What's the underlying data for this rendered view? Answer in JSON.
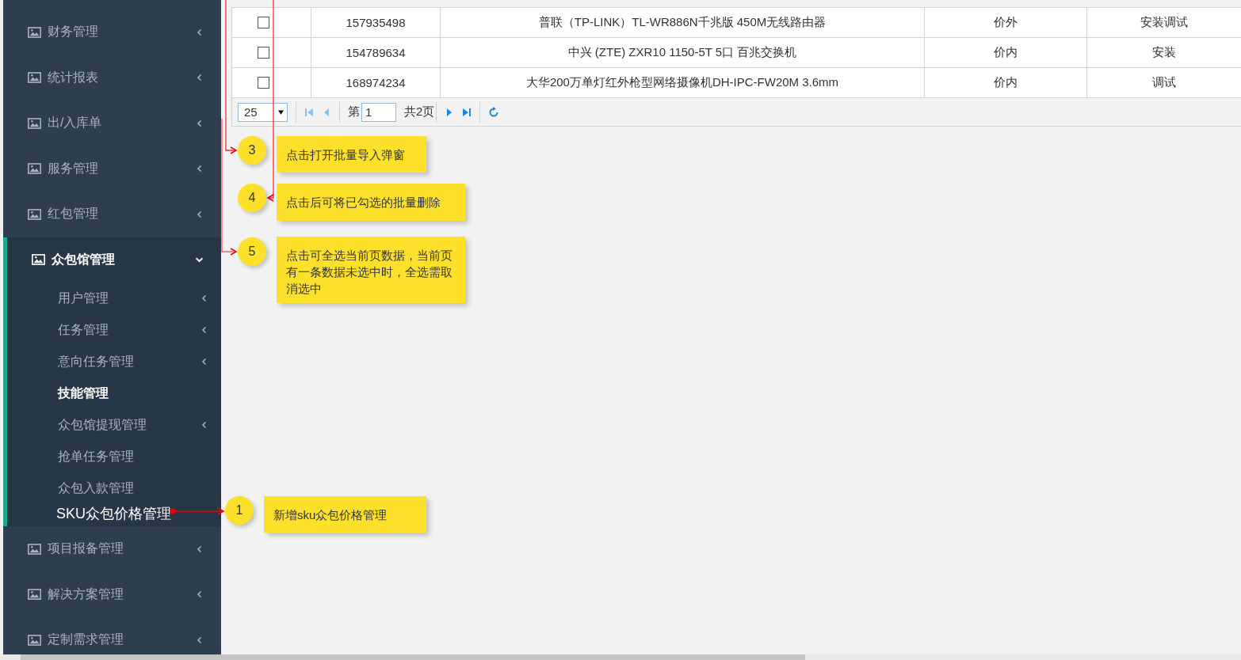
{
  "sidebar": {
    "items": [
      {
        "label": "财务管理",
        "kind": "group",
        "expanded": false
      },
      {
        "label": "统计报表",
        "kind": "group",
        "expanded": false
      },
      {
        "label": "出/入库单",
        "kind": "group",
        "expanded": false
      },
      {
        "label": "服务管理",
        "kind": "group",
        "expanded": false
      },
      {
        "label": "红包管理",
        "kind": "group",
        "expanded": false
      },
      {
        "label": "众包馆管理",
        "kind": "group",
        "expanded": true,
        "children": [
          {
            "label": "用户管理",
            "kind": "submenu",
            "selected": false
          },
          {
            "label": "任务管理",
            "kind": "submenu",
            "selected": false
          },
          {
            "label": "意向任务管理",
            "kind": "submenu",
            "selected": false
          },
          {
            "label": "技能管理",
            "kind": "link",
            "selected": true
          },
          {
            "label": "众包馆提现管理",
            "kind": "submenu",
            "selected": false
          },
          {
            "label": "抢单任务管理",
            "kind": "link",
            "selected": false
          },
          {
            "label": "众包入款管理",
            "kind": "link",
            "selected": false
          },
          {
            "label": "SKU众包价格管理",
            "kind": "new"
          }
        ]
      },
      {
        "label": "项目报备管理",
        "kind": "group",
        "expanded": false
      },
      {
        "label": "解决方案管理",
        "kind": "group",
        "expanded": false
      },
      {
        "label": "定制需求管理",
        "kind": "group",
        "expanded": false
      }
    ]
  },
  "table": {
    "rows": [
      {
        "checked": false,
        "cells": [
          "157935498",
          "普联（TP-LINK）TL-WR886N千兆版 450M无线路由器",
          "价外",
          "安装调试"
        ]
      },
      {
        "checked": false,
        "cells": [
          "154789634",
          "中兴 (ZTE) ZXR10 1150-5T 5口 百兆交换机",
          "价内",
          "安装"
        ]
      },
      {
        "checked": false,
        "cells": [
          "168974234",
          "大华200万单灯红外枪型网络摄像机DH-IPC-FW20M 3.6mm",
          "价内",
          "调试"
        ]
      }
    ]
  },
  "pager": {
    "page_size": "25",
    "page_prefix": "第",
    "page": "1",
    "total": "共2页"
  },
  "callouts": [
    {
      "number": "3",
      "text": "点击打开批量导入弹窗"
    },
    {
      "number": "4",
      "text": "点击后可将已勾选的批量删除"
    },
    {
      "number": "5",
      "text": "点击可全选当前页数据，当前页有一条数据未选中时，全选需取消选中"
    },
    {
      "number": "1",
      "text": "新增sku众包价格管理"
    }
  ]
}
